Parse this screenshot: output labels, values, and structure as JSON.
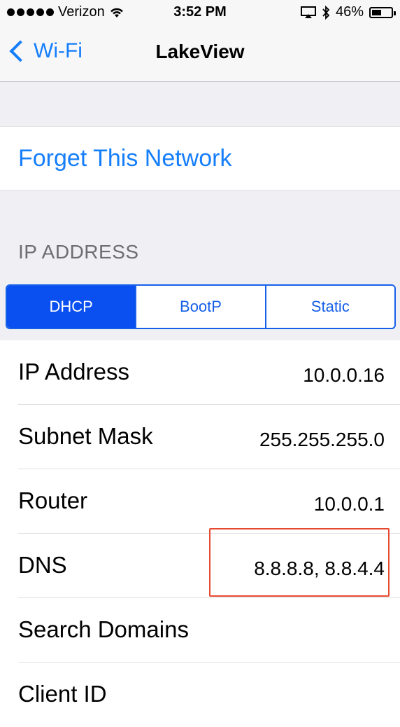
{
  "status_bar": {
    "carrier": "Verizon",
    "time": "3:52 PM",
    "battery": "46%"
  },
  "nav": {
    "back_label": "Wi-Fi",
    "title": "LakeView"
  },
  "forget": {
    "label": "Forget This Network"
  },
  "ip_section": {
    "header": "IP ADDRESS",
    "segments": [
      "DHCP",
      "BootP",
      "Static"
    ],
    "selected": "DHCP"
  },
  "rows": [
    {
      "label": "IP Address",
      "value": "10.0.0.16"
    },
    {
      "label": "Subnet Mask",
      "value": "255.255.255.0"
    },
    {
      "label": "Router",
      "value": "10.0.0.1"
    },
    {
      "label": "DNS",
      "value": "8.8.8.8, 8.8.4.4"
    },
    {
      "label": "Search Domains",
      "value": ""
    },
    {
      "label": "Client ID",
      "value": ""
    }
  ],
  "colors": {
    "accent": "#157efb",
    "segment_active": "#0a4ff0",
    "highlight_box": "#e5492f"
  }
}
